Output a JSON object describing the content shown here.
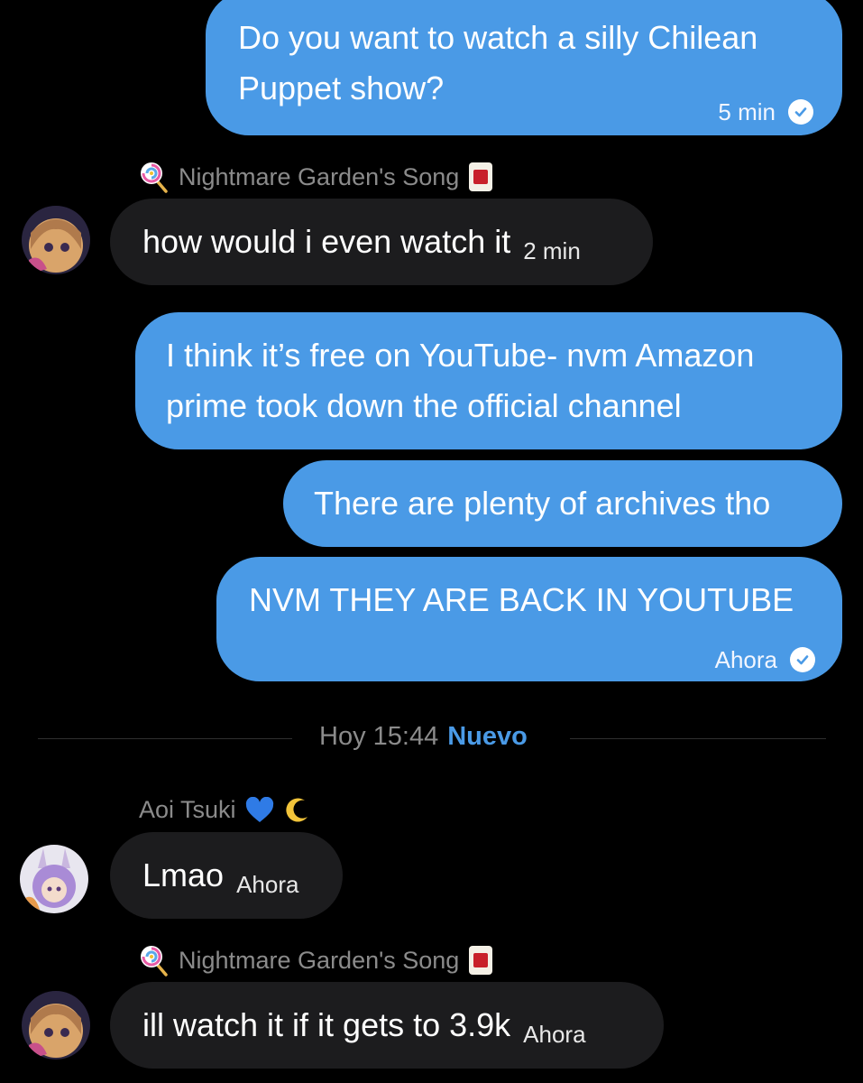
{
  "messages": [
    {
      "text_line1": "Do you want to watch a silly Chilean",
      "text_line2": "Puppet show?",
      "time": "5 min"
    },
    {
      "sender": "Nightmare Garden's Song",
      "text": "how would i even watch it",
      "time": "2 min"
    },
    {
      "text_line1": "I think it’s free on YouTube- nvm Amazon",
      "text_line2": "prime took down the official channel"
    },
    {
      "text": "There are plenty of archives tho"
    },
    {
      "text": "NVM THEY ARE BACK IN YOUTUBE",
      "time": "Ahora"
    },
    {
      "sender": "Aoi Tsuki",
      "text": "Lmao",
      "time": "Ahora"
    },
    {
      "sender": "Nightmare Garden's Song",
      "text": "ill watch it if it gets to 3.9k",
      "time": "Ahora"
    }
  ],
  "divider": {
    "time": "Hoy 15:44",
    "label": "Nuevo"
  },
  "icons": {
    "lollipop": "lollipop-icon",
    "mahjong": "mahjong-tile-icon",
    "heart": "blue-heart-icon",
    "moon": "crescent-moon-icon",
    "check": "check-circle-icon"
  },
  "colors": {
    "outgoing": "#4a9ae6",
    "incoming": "#1c1c1e",
    "accent": "#4a9ae6",
    "muted": "#8b8b8b"
  }
}
